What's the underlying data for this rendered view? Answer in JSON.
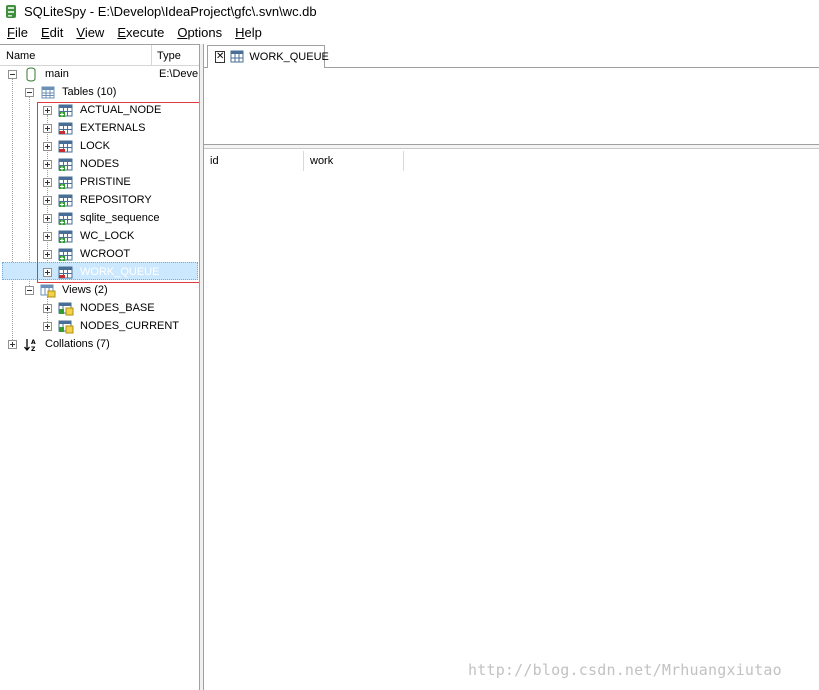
{
  "window": {
    "title": "SQLiteSpy - E:\\Develop\\IdeaProject\\gfc\\.svn\\wc.db"
  },
  "menu": [
    {
      "mnemonic": "F",
      "rest": "ile"
    },
    {
      "mnemonic": "E",
      "rest": "dit"
    },
    {
      "mnemonic": "V",
      "rest": "iew"
    },
    {
      "mnemonic": "E",
      "rest": "xecute"
    },
    {
      "mnemonic": "O",
      "rest": "ptions"
    },
    {
      "mnemonic": "H",
      "rest": "elp"
    }
  ],
  "tree": {
    "headers": {
      "name": "Name",
      "type": "Type"
    },
    "db": {
      "name": "main",
      "type": "E:\\Deve"
    },
    "tables_label": "Tables (10)",
    "tables": [
      "ACTUAL_NODE",
      "EXTERNALS",
      "LOCK",
      "NODES",
      "PRISTINE",
      "REPOSITORY",
      "sqlite_sequence",
      "WC_LOCK",
      "WCROOT",
      "WORK_QUEUE"
    ],
    "selected_table": "WORK_QUEUE",
    "views_label": "Views (2)",
    "views": [
      "NODES_BASE",
      "NODES_CURRENT"
    ],
    "collations_label": "Collations (7)"
  },
  "tab": {
    "label": "WORK_QUEUE"
  },
  "grid": {
    "columns": [
      "id",
      "work"
    ]
  },
  "watermark": "http://blog.csdn.net/Mrhuangxiutao",
  "colors": {
    "selection": "#cce8ff",
    "highlight_box": "#e0393e"
  }
}
